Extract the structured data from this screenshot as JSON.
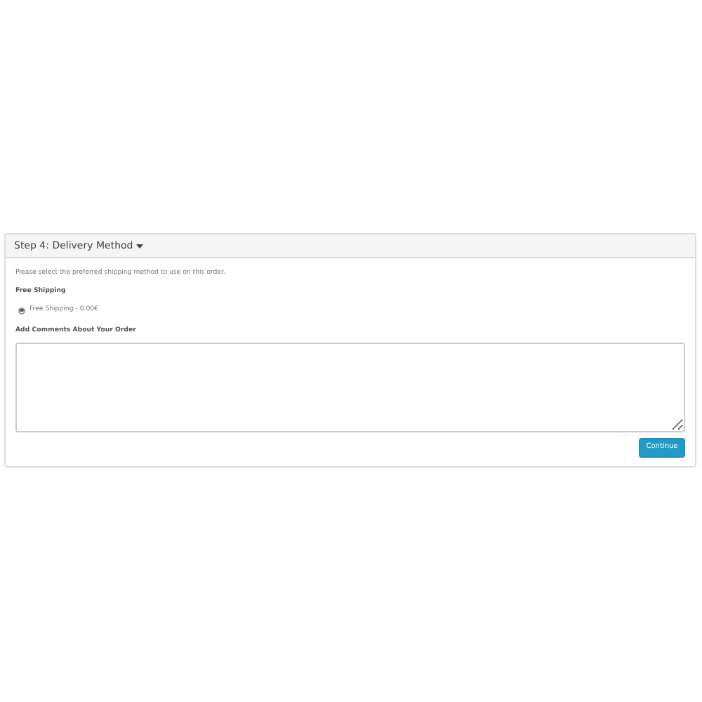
{
  "panel": {
    "title": "Step 4: Delivery Method",
    "intro": "Please select the preferred shipping method to use on this order.",
    "methods_heading": "Free Shipping",
    "methods": [
      {
        "label": "Free Shipping - 0.00€",
        "selected": true
      }
    ],
    "comments_label": "Add Comments About Your Order",
    "button": "Continue"
  }
}
